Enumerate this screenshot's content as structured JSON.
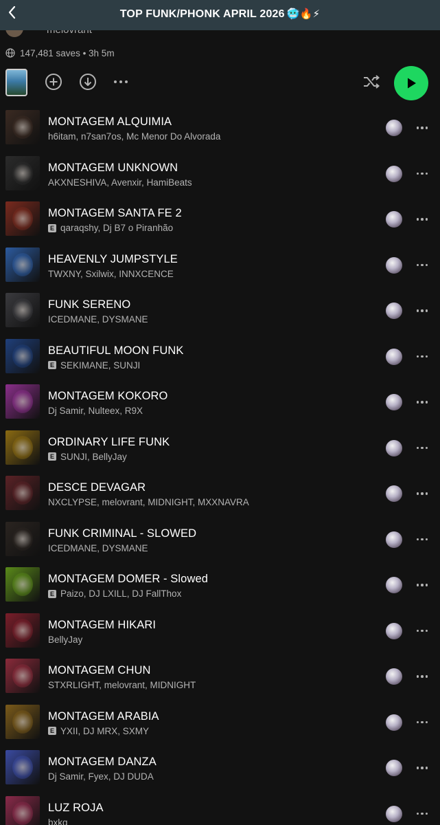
{
  "header": {
    "title": "TOP FUNK/PHONK APRIL 2026",
    "title_emoji": "🥶🔥⚡",
    "back_icon": "chevron-left-icon"
  },
  "owner": {
    "text": "melovrant"
  },
  "meta": {
    "saves_text": "147,481 saves • 3h 5m",
    "icon": "globe-icon"
  },
  "controls": {
    "add_icon": "plus-circle-icon",
    "download_icon": "download-circle-icon",
    "more_icon": "more-horizontal-icon",
    "shuffle_icon": "shuffle-icon",
    "play_icon": "play-icon",
    "play_color": "#1ed760"
  },
  "tracks": [
    {
      "title": "MONTAGEM ALQUIMIA",
      "artists": "h6itam, n7san7os, Mc Menor Do Alvorada",
      "explicit": false,
      "art": "#3a2a22"
    },
    {
      "title": "MONTAGEM UNKNOWN",
      "artists": "AKXNESHIVA, Avenxir, HamiBeats",
      "explicit": false,
      "art": "#2b2b2b"
    },
    {
      "title": "MONTAGEM SANTA FE 2",
      "artists": "qaraqshy, Dj B7 o Piranhão",
      "explicit": true,
      "art": "#7a2a1e"
    },
    {
      "title": "HEAVENLY JUMPSTYLE",
      "artists": "TWXNY, Sxilwix, INNXCENCE",
      "explicit": false,
      "art": "#2c5a9e"
    },
    {
      "title": "FUNK SERENO",
      "artists": "ICEDMANE, DYSMANE",
      "explicit": false,
      "art": "#3a3a3e"
    },
    {
      "title": "BEAUTIFUL MOON FUNK",
      "artists": "SEKIMANE, SUNJI",
      "explicit": true,
      "art": "#1f3f7a"
    },
    {
      "title": "MONTAGEM KOKORO",
      "artists": "Dj Samir, Nulteex, R9X",
      "explicit": false,
      "art": "#8a2f8a"
    },
    {
      "title": "ORDINARY LIFE FUNK",
      "artists": "SUNJI, BellyJay",
      "explicit": true,
      "art": "#8a6a12"
    },
    {
      "title": "DESCE DEVAGAR",
      "artists": "NXCLYPSE, melovrant, MIDNIGHT, MXXNAVRA",
      "explicit": false,
      "art": "#5a2226"
    },
    {
      "title": "FUNK CRIMINAL - SLOWED",
      "artists": "ICEDMANE, DYSMANE",
      "explicit": false,
      "art": "#2a2420"
    },
    {
      "title": "MONTAGEM DOMER - Slowed",
      "artists": "Paizo, DJ LXILL, DJ FallThox",
      "explicit": true,
      "art": "#5a8a1a"
    },
    {
      "title": "MONTAGEM HIKARI",
      "artists": "BellyJay",
      "explicit": false,
      "art": "#7a1e2a"
    },
    {
      "title": "MONTAGEM CHUN",
      "artists": "STXRLIGHT, melovrant, MIDNIGHT",
      "explicit": false,
      "art": "#8a2a3a"
    },
    {
      "title": "MONTAGEM ARABIA",
      "artists": "YXII, DJ MRX, SXMY",
      "explicit": true,
      "art": "#7a5a1a"
    },
    {
      "title": "MONTAGEM DANZA",
      "artists": "Dj Samir, Fyex, DJ DUDA",
      "explicit": false,
      "art": "#3a4aa0"
    },
    {
      "title": "LUZ ROJA",
      "artists": "bxkq",
      "explicit": false,
      "art": "#8a2a4a"
    }
  ],
  "track_icons": {
    "download": "downloaded-disc-icon",
    "more": "more-horizontal-icon",
    "explicit_label": "E"
  }
}
